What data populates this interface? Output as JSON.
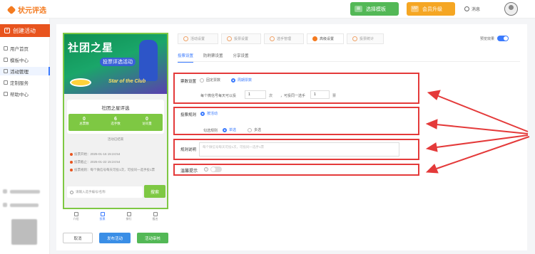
{
  "app": {
    "logo_text": "状元评选"
  },
  "header": {
    "template_button": "选择模板",
    "template_icon": "template-icon",
    "vip_badge": "VIP",
    "vip_button": "会员升级",
    "message": "消息",
    "template_color": "#53b856",
    "vip_color": "#f5a623"
  },
  "sidebar": {
    "create_button": "创建活动",
    "items": [
      {
        "label": "用户首页",
        "icon": "home-icon"
      },
      {
        "label": "模板中心",
        "icon": "template-icon"
      },
      {
        "label": "活动管理",
        "icon": "activity-icon",
        "active": true
      },
      {
        "label": "定制服务",
        "icon": "custom-service-icon"
      },
      {
        "label": "帮助中心",
        "icon": "help-icon"
      }
    ]
  },
  "preview": {
    "banner_title": "社团之星",
    "banner_subtitle": "投票评选活动",
    "banner_english": "Star of the Club",
    "card_title": "社团之星评选",
    "stats": [
      {
        "value": "0",
        "label": "总票数"
      },
      {
        "value": "6",
        "label": "选手数"
      },
      {
        "value": "0",
        "label": "访问量"
      }
    ],
    "countdown": "活动已结束",
    "info": [
      "投票开始：2025-01-16 15:24:54",
      "投票截止：2025-01-22 15:24:54",
      "投票规则：每个微信号每天可投1次，可投同一选手投1票"
    ],
    "search_placeholder": "请输入选手编号/名称",
    "search_button": "搜索",
    "tabbar": [
      "介绍",
      "投票",
      "排行",
      "报名"
    ],
    "accent": "#7ec843"
  },
  "bottom_buttons": {
    "cancel": "取消",
    "publish": "发布活动",
    "save": "活动审核"
  },
  "steps": [
    {
      "label": "活动设置"
    },
    {
      "label": "投票设置"
    },
    {
      "label": "选手管理"
    },
    {
      "label": "高级设置",
      "active": true
    },
    {
      "label": "投票统计"
    }
  ],
  "preview_toggle": {
    "label": "预览效果",
    "on": true
  },
  "subtabs": [
    {
      "label": "投票设置",
      "active": true
    },
    {
      "label": "防刷票设置"
    },
    {
      "label": "分享设置"
    }
  ],
  "settings": {
    "vote_setting_label": "票数设置",
    "vote_fixed": "固定票数",
    "vote_cycle": "周期票数",
    "per_day_text": "每个微信号每天可以投",
    "per_day_value": "1",
    "times_unit": "次",
    "same_player_text": "，可投同一选手",
    "same_player_value": "1",
    "votes_unit": "票",
    "rule_label": "投票规则",
    "rule_option": "按活动",
    "check_rule_label": "勾选规则",
    "single": "单选",
    "multi": "多选",
    "desc_label": "规则说明",
    "desc_placeholder": "每个微信号每天可投1次，可投同一选手1票",
    "tip_label": "温馨提示",
    "tip_on": false
  },
  "annotation_color": "#e43a3a"
}
